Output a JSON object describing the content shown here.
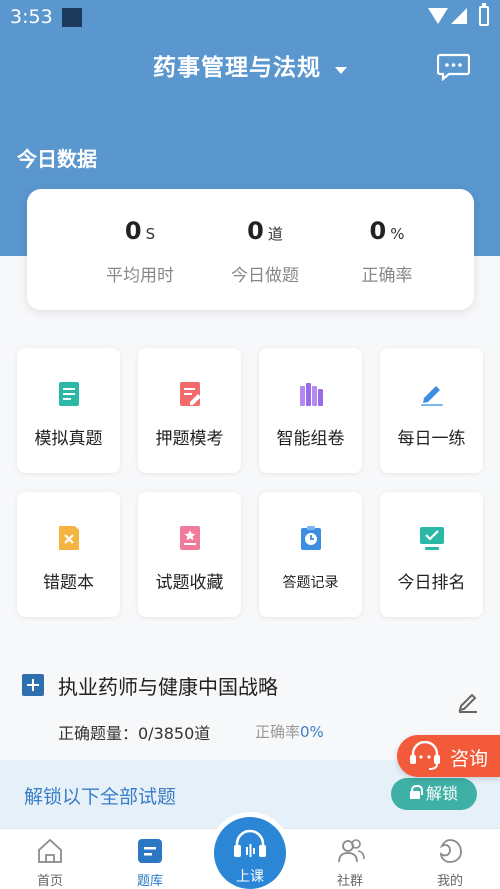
{
  "status_bar": {
    "time": "3:53"
  },
  "header": {
    "title": "药事管理与法规"
  },
  "today": {
    "label": "今日数据",
    "stats": [
      {
        "value": "0",
        "unit": "S",
        "label": "平均用时"
      },
      {
        "value": "0",
        "unit": "道",
        "label": "今日做题"
      },
      {
        "value": "0",
        "unit": "%",
        "label": "正确率"
      }
    ]
  },
  "tiles": [
    {
      "label": "模拟真题",
      "icon": "document-icon",
      "color": "#2bb8a6"
    },
    {
      "label": "押题模考",
      "icon": "edit-document-icon",
      "color": "#f26a6a"
    },
    {
      "label": "智能组卷",
      "icon": "books-icon",
      "color": "#9b6ae6"
    },
    {
      "label": "每日一练",
      "icon": "pen-icon",
      "color": "#3d8ee0"
    },
    {
      "label": "错题本",
      "icon": "error-note-icon",
      "color": "#f5b342"
    },
    {
      "label": "试题收藏",
      "icon": "star-book-icon",
      "color": "#f07a9a"
    },
    {
      "label": "答题记录",
      "icon": "clock-clipboard-icon",
      "color": "#3d8ee0"
    },
    {
      "label": "今日排名",
      "icon": "monitor-check-icon",
      "color": "#2bb8a6"
    }
  ],
  "chapter": {
    "title": "执业药师与健康中国战略",
    "correct_label": "正确题量：0/3850道",
    "rate_label": "正确率",
    "rate_value": "0%"
  },
  "unlock": {
    "text": "解锁以下全部试题",
    "button": "解锁"
  },
  "consult": {
    "label": "咨询"
  },
  "tabbar": [
    {
      "label": "首页",
      "icon": "home-icon"
    },
    {
      "label": "题库",
      "icon": "question-bank-icon",
      "active": true
    },
    {
      "label": "上课",
      "icon": "headphones-icon"
    },
    {
      "label": "社群",
      "icon": "community-icon"
    },
    {
      "label": "我的",
      "icon": "profile-icon"
    }
  ]
}
